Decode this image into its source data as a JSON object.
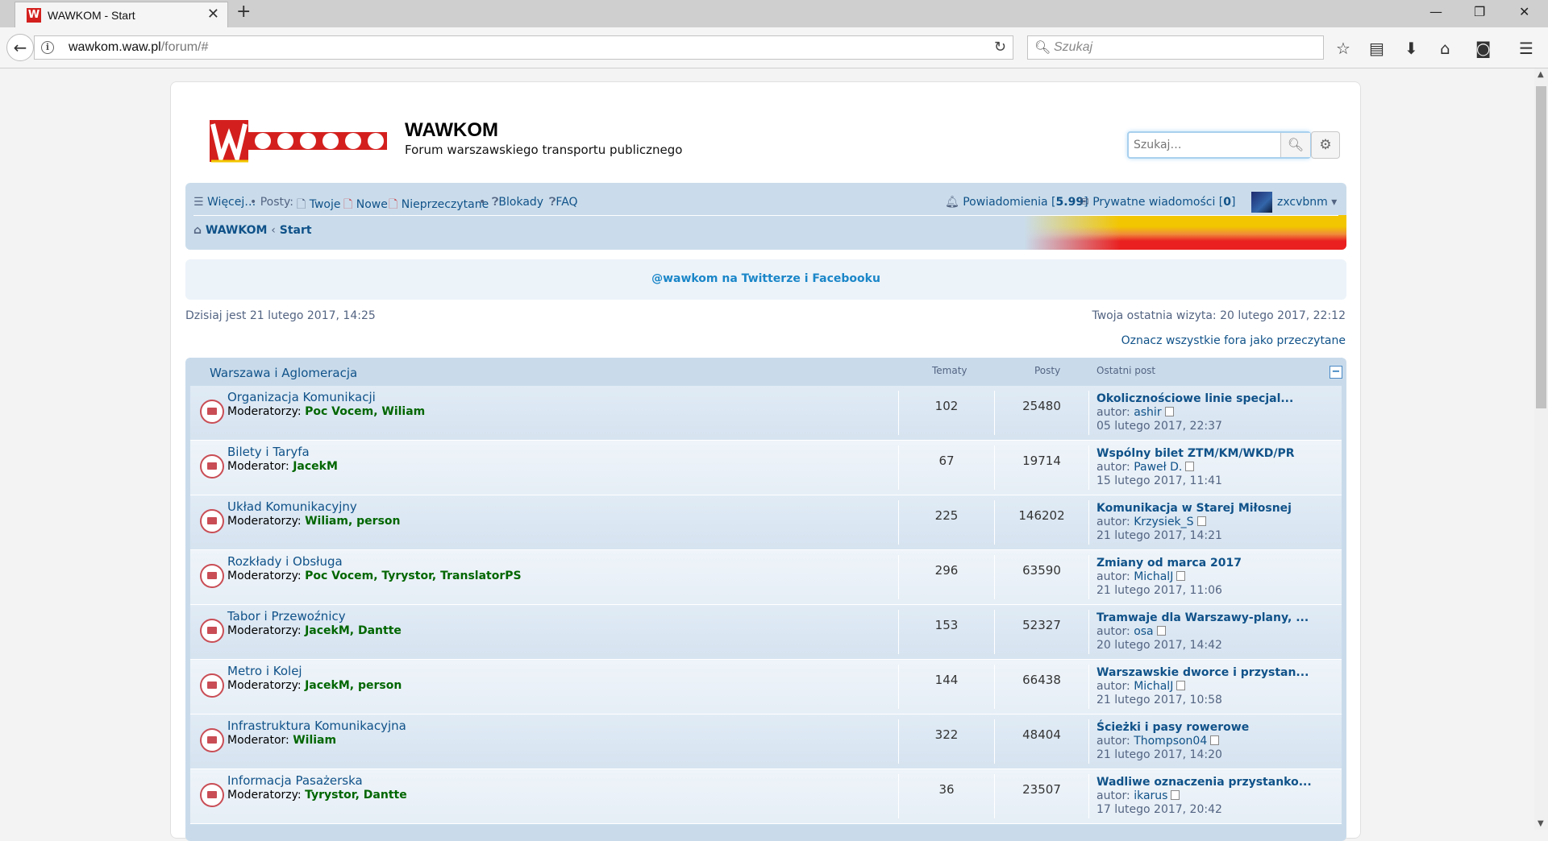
{
  "browser": {
    "tab_title": "WAWKOM - Start",
    "url_host": "wawkom.waw.pl",
    "url_path": "/forum/#",
    "search_placeholder": "Szukaj"
  },
  "header": {
    "logo_text": "WAWKOM",
    "site_title": "WAWKOM",
    "site_description": "Forum warszawskiego transportu publicznego",
    "search_placeholder": "Szukaj…"
  },
  "navbar": {
    "more": "Więcej…",
    "posts_label": "• Posty:",
    "yours": "Twoje",
    "new": "Nowe",
    "unread": "Nieprzeczytane",
    "bullet": "•",
    "bans": "Blokady",
    "faq": "FAQ",
    "notifications": "Powiadomienia",
    "notifications_count": "5.99",
    "pm": "Prywatne wiadomości",
    "pm_count": "0",
    "username": "zxcvbnm"
  },
  "breadcrumb": {
    "home": "WAWKOM",
    "sep": "‹",
    "current": "Start"
  },
  "announcement": "@wawkom na Twitterze i Facebooku",
  "info": {
    "now": "Dzisiaj jest 21 lutego 2017, 14:25",
    "last_visit": "Twoja ostatnia wizyta: 20 lutego 2017, 22:12",
    "mark_read": "Oznacz wszystkie fora jako przeczytane"
  },
  "category": {
    "title": "Warszawa i Aglomeracja",
    "col_topics": "Tematy",
    "col_posts": "Posty",
    "col_last": "Ostatni post",
    "author_prefix": "autor:",
    "forums": [
      {
        "name": "Organizacja Komunikacji",
        "mod_label": "Moderatorzy:",
        "mods": "Poc Vocem, Wiliam",
        "topics": "102",
        "posts": "25480",
        "last_title": "Okolicznościowe linie specjal...",
        "last_author": "ashir",
        "last_date": "05 lutego 2017, 22:37"
      },
      {
        "name": "Bilety i Taryfa",
        "mod_label": "Moderator:",
        "mods": "JacekM",
        "topics": "67",
        "posts": "19714",
        "last_title": "Wspólny bilet ZTM/KM/WKD/PR",
        "last_author": "Paweł D.",
        "last_date": "15 lutego 2017, 11:41"
      },
      {
        "name": "Układ Komunikacyjny",
        "mod_label": "Moderatorzy:",
        "mods": "Wiliam, person",
        "topics": "225",
        "posts": "146202",
        "last_title": "Komunikacja w Starej Miłosnej",
        "last_author": "Krzysiek_S",
        "last_date": "21 lutego 2017, 14:21"
      },
      {
        "name": "Rozkłady i Obsługa",
        "mod_label": "Moderatorzy:",
        "mods": "Poc Vocem, Tyrystor, TranslatorPS",
        "topics": "296",
        "posts": "63590",
        "last_title": "Zmiany od marca 2017",
        "last_author": "MichalJ",
        "last_date": "21 lutego 2017, 11:06"
      },
      {
        "name": "Tabor i Przewoźnicy",
        "mod_label": "Moderatorzy:",
        "mods": "JacekM, Dantte",
        "topics": "153",
        "posts": "52327",
        "last_title": "Tramwaje dla Warszawy-plany, ...",
        "last_author": "osa",
        "last_date": "20 lutego 2017, 14:42"
      },
      {
        "name": "Metro i Kolej",
        "mod_label": "Moderatorzy:",
        "mods": "JacekM, person",
        "topics": "144",
        "posts": "66438",
        "last_title": "Warszawskie dworce i przystan...",
        "last_author": "MichalJ",
        "last_date": "21 lutego 2017, 10:58"
      },
      {
        "name": "Infrastruktura Komunikacyjna",
        "mod_label": "Moderator:",
        "mods": "Wiliam",
        "topics": "322",
        "posts": "48404",
        "last_title": "Ścieżki i pasy rowerowe",
        "last_author": "Thompson04",
        "last_date": "21 lutego 2017, 14:20"
      },
      {
        "name": "Informacja Pasażerska",
        "mod_label": "Moderatorzy:",
        "mods": "Tyrystor, Dantte",
        "topics": "36",
        "posts": "23507",
        "last_title": "Wadliwe oznaczenia przystanko...",
        "last_author": "ikarus",
        "last_date": "17 lutego 2017, 20:42"
      }
    ]
  }
}
